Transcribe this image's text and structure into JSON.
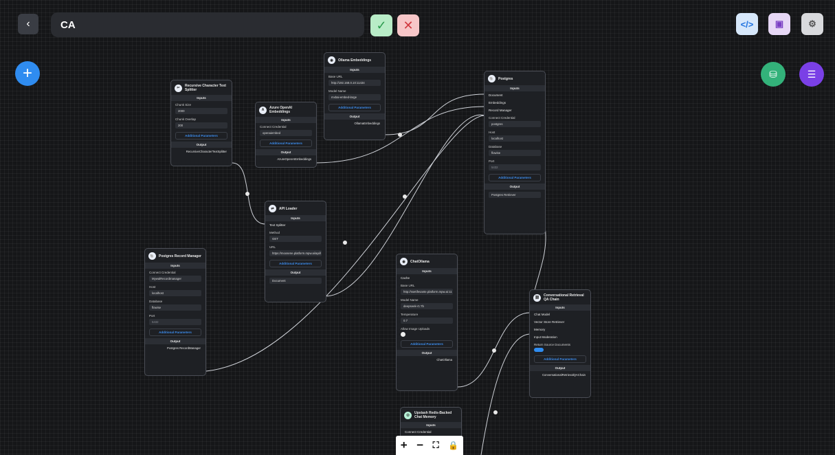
{
  "header": {
    "back_icon": "chevron-left-icon",
    "title": "CA",
    "confirm_icon": "check-icon",
    "cancel_icon": "x-icon",
    "code_icon": "</>",
    "save_icon": "save-icon",
    "settings_icon": "gear-icon"
  },
  "fabs": {
    "add": "+",
    "db_icon": "database-plus-icon",
    "chat_icon": "chat-icon"
  },
  "nodes": {
    "splitter": {
      "title": "Recursive Character Text Splitter",
      "inputs": "Inputs",
      "chunk_size_label": "Chunk Size",
      "chunk_size": "2000",
      "chunk_overlap_label": "Chunk Overlap",
      "chunk_overlap": "200",
      "addl": "Additional Parameters",
      "output": "Output",
      "output_name": "RecursiveCharacterTextSplitter"
    },
    "azure": {
      "title": "Azure OpenAI Embeddings",
      "inputs": "Inputs",
      "cred_label": "Connect Credential",
      "cred": "openaiembed",
      "addl": "Additional Parameters",
      "output": "Output",
      "output_name": "AzureOpenAIEmbeddings"
    },
    "ollama_emb": {
      "title": "Ollama Embeddings",
      "inputs": "Inputs",
      "base_url_label": "Base URL",
      "base_url": "http://192.168.0.10:11434",
      "model_label": "Model Name",
      "model": "mxbai-embed-large",
      "addl": "Additional Parameters",
      "output": "Output",
      "output_name": "OllamaEmbeddings"
    },
    "postgres": {
      "title": "Postgres",
      "inputs": "Inputs",
      "in_document": "Document",
      "in_embeddings": "Embeddings",
      "in_record_manager": "Record Manager",
      "cred_label": "Connect Credential",
      "cred": "postgres",
      "host_label": "Host",
      "host": "localhost",
      "db_label": "Database",
      "db": "flowise",
      "port_label": "Port",
      "port": "5432",
      "addl": "Additional Parameters",
      "output": "Output",
      "output_name": "Postgres Retriever"
    },
    "api_loader": {
      "title": "API Loader",
      "inputs": "Inputs",
      "in_splitter": "Text Splitter",
      "method_label": "Method",
      "method": "GET",
      "url_label": "URL",
      "url": "https://moosene.platform.mpw.ai/api/l",
      "addl": "Additional Parameters",
      "output": "Output",
      "output_name": "Document"
    },
    "record_manager": {
      "title": "Postgres Record Manager",
      "inputs": "Inputs",
      "cred_label": "Connect Credential",
      "cred": "MywalRecordmanager",
      "host_label": "Host",
      "host": "localhost",
      "db_label": "Database",
      "db": "flowise",
      "port_label": "Port",
      "port": "5432",
      "addl": "Additional Parameters",
      "output": "Output",
      "output_name": "Postgres RecordManager"
    },
    "chat_ollama": {
      "title": "ChatOllama",
      "inputs": "Inputs",
      "in_cache": "Cache",
      "base_url_label": "Base URL",
      "base_url": "http://ssetifesante.platform.mpw.ai:11",
      "model_label": "Model Name",
      "model": "deepseek-r1:7b",
      "temp_label": "Temperature",
      "temp": "0.7",
      "uploads_label": "Allow Image Uploads",
      "addl": "Additional Parameters",
      "output": "Output",
      "output_name": "ChatOllama"
    },
    "qa_chain": {
      "title": "Conversational Retrieval QA Chain",
      "inputs": "Inputs",
      "in_chat_model": "Chat Model",
      "in_retriever": "Vector Store Retriever",
      "in_memory": "Memory",
      "in_moderation": "Input Moderation",
      "return_docs_label": "Return Source Documents",
      "addl": "Additional Parameters",
      "output": "Output",
      "output_name": "ConversationalRetrievalQAChain"
    },
    "upstash": {
      "title": "Upstash Redis-Backed Chat Memory",
      "inputs": "Inputs",
      "cred_label": "Connect Credential"
    }
  },
  "zoom": {
    "in": "+",
    "out": "−",
    "fit": "⛶",
    "lock": "lock-icon"
  }
}
